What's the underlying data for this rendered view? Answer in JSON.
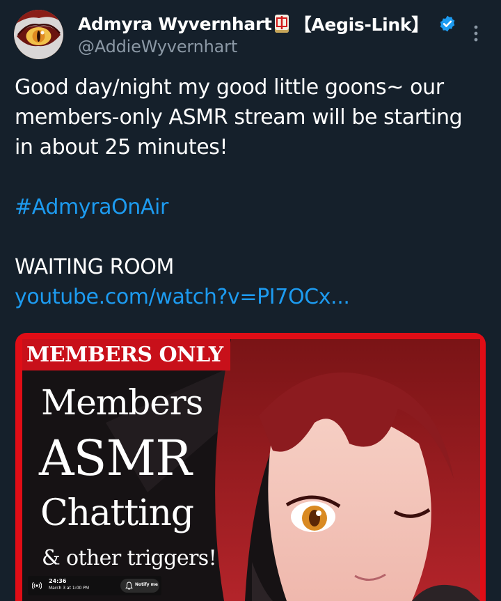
{
  "post": {
    "author": {
      "display_name": "Admyra Wyvernhart",
      "name_affix": "【Aegis-Link】",
      "handle": "@AddieWyvernhart",
      "verified": true,
      "avatar_icon": "avatar-dragon-eye",
      "name_emoji_icon": "mahjong-tile-icon"
    },
    "text_lines": [
      "Good day/night my good little goons~ our",
      "members-only ASMR stream will be starting",
      "in about 25 minutes!"
    ],
    "hashtag": "#AdmyraOnAir",
    "label": "WAITING ROOM",
    "link": "youtube.com/watch?v=PI7OCx..."
  },
  "thumbnail": {
    "banner": "MEMBERS ONLY",
    "title_1": "Members",
    "title_2": "ASMR",
    "title_3": "Chatting",
    "title_4": "& other triggers!",
    "stream_duration": "24:36",
    "stream_date": "March 3 at 1:00 PM",
    "notify_label": "Notify me"
  },
  "colors": {
    "background": "#15202b",
    "link": "#1d9bf0",
    "handle": "#8b98a5",
    "thumbnail_frame": "#e00d16",
    "verified": "#1d9bf0"
  }
}
